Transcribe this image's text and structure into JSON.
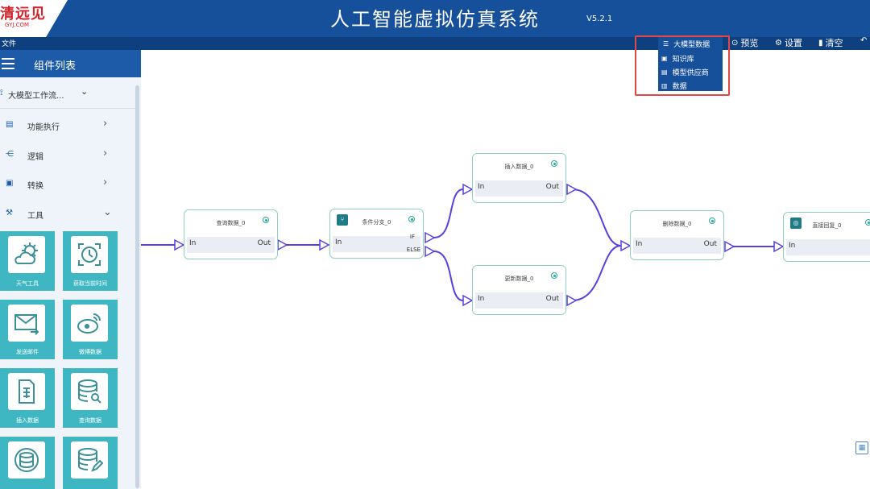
{
  "header": {
    "logo_main": "清远见",
    "logo_sub": "GYJ.COM",
    "title": "人工智能虚拟仿真系统",
    "version": "V5.2.1"
  },
  "menubar": {
    "file_label": "文件"
  },
  "toolbar": {
    "model_data_label": "大模型数据",
    "preview_label": "预览",
    "settings_label": "设置",
    "clear_label": "清空"
  },
  "dropdown": {
    "items": [
      {
        "label": "知识库",
        "icon": "knowledge-icon"
      },
      {
        "label": "模型供应商",
        "icon": "supplier-icon"
      },
      {
        "label": "数据",
        "icon": "data-icon"
      }
    ]
  },
  "sidebar": {
    "title": "组件列表",
    "workflow_label": "大模型工作流...",
    "categories": [
      {
        "label": "功能执行",
        "icon": "function-icon",
        "expanded": false
      },
      {
        "label": "逻辑",
        "icon": "logic-icon",
        "expanded": false
      },
      {
        "label": "转换",
        "icon": "convert-icon",
        "expanded": false
      },
      {
        "label": "工具",
        "icon": "tool-icon",
        "expanded": true
      }
    ],
    "tools": [
      {
        "label": "天气工具",
        "icon": "weather-icon"
      },
      {
        "label": "获取当前时间",
        "icon": "clock-icon"
      },
      {
        "label": "发送邮件",
        "icon": "email-icon"
      },
      {
        "label": "微博数据",
        "icon": "weibo-icon"
      },
      {
        "label": "插入数据",
        "icon": "insert-data-icon"
      },
      {
        "label": "查询数据",
        "icon": "query-data-icon"
      },
      {
        "label": "",
        "icon": "database-sync-icon"
      },
      {
        "label": "",
        "icon": "database-edit-icon"
      }
    ]
  },
  "nodes": [
    {
      "id": "query",
      "title": "查询数据_0",
      "in": "In",
      "out": "Out"
    },
    {
      "id": "branch",
      "title": "条件分支_0",
      "in": "In",
      "if_label": "IF",
      "else_label": "ELSE"
    },
    {
      "id": "insert",
      "title": "插入数据_0",
      "in": "In",
      "out": "Out"
    },
    {
      "id": "update",
      "title": "更新数据_0",
      "in": "In",
      "out": "Out"
    },
    {
      "id": "delete",
      "title": "删除数据_0",
      "in": "In",
      "out": "Out"
    },
    {
      "id": "reply",
      "title": "直接回复_0",
      "in": "In"
    }
  ],
  "colors": {
    "header": "#17509a",
    "tile": "#3fb7c2",
    "edge": "#5b3fe0",
    "highlight": "#e64545"
  }
}
